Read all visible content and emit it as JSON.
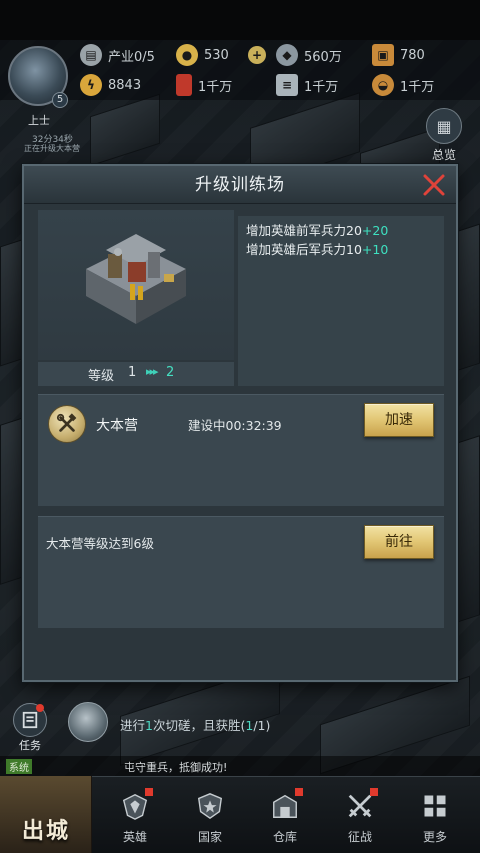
{
  "status": {
    "rank": "上士",
    "level": "5",
    "build_timer": "32分34秒",
    "build_state": "正在升级大本营",
    "overview_label": "总览"
  },
  "resources": [
    {
      "name": "industry",
      "value": "产业0/5",
      "icon": "industry-icon",
      "color": "#9aa3a8"
    },
    {
      "name": "gold",
      "value": "530",
      "icon": "gold-coin-icon",
      "color": "#d8b24a"
    },
    {
      "name": "add",
      "value": "",
      "icon": "plus-icon",
      "color": "#c9b05a"
    },
    {
      "name": "steel",
      "value": "560万",
      "icon": "steel-icon",
      "color": "#8b97a0"
    },
    {
      "name": "crate",
      "value": "780",
      "icon": "crate-icon",
      "color": "#c98a3a"
    },
    {
      "name": "power",
      "value": "8843",
      "icon": "lightning-icon",
      "color": "#d9a63b"
    },
    {
      "name": "oil",
      "value": "1千万",
      "icon": "oil-barrel-icon",
      "color": "#c0392b"
    },
    {
      "name": "metal",
      "value": "1千万",
      "icon": "metal-bars-icon",
      "color": "#aab4ba"
    },
    {
      "name": "food",
      "value": "1千万",
      "icon": "food-icon",
      "color": "#c88a3a"
    }
  ],
  "dialog": {
    "title": "升级训练场",
    "level_label": "等级",
    "level_from": "1",
    "level_arrow": "▸▸▸",
    "level_to": "2",
    "effects": [
      {
        "text": "增加英雄前军兵力20",
        "bonus": "+20"
      },
      {
        "text": "增加英雄后军兵力10",
        "bonus": "+10"
      }
    ],
    "building_name": "大本营",
    "building_status": "建设中00:32:39",
    "speedup_label": "加速",
    "requirement": "大本营等级达到6级",
    "goto_label": "前往"
  },
  "quest": {
    "task_label": "任务",
    "text_before": "进行",
    "count_hl": "1",
    "text_after": "次切磋，且获胜(",
    "progress_hl": "1",
    "progress_total": "/1)"
  },
  "chat": {
    "channel": "系统",
    "message": "屯守重兵，抵御成功!"
  },
  "nav": {
    "go_out": "出城",
    "items": [
      {
        "label": "英雄",
        "icon": "hero-emblem-icon",
        "badge": true
      },
      {
        "label": "国家",
        "icon": "shield-star-icon",
        "badge": false
      },
      {
        "label": "仓库",
        "icon": "warehouse-icon",
        "badge": true
      },
      {
        "label": "征战",
        "icon": "crossed-swords-icon",
        "badge": true
      },
      {
        "label": "更多",
        "icon": "grid-icon",
        "badge": false
      }
    ]
  }
}
